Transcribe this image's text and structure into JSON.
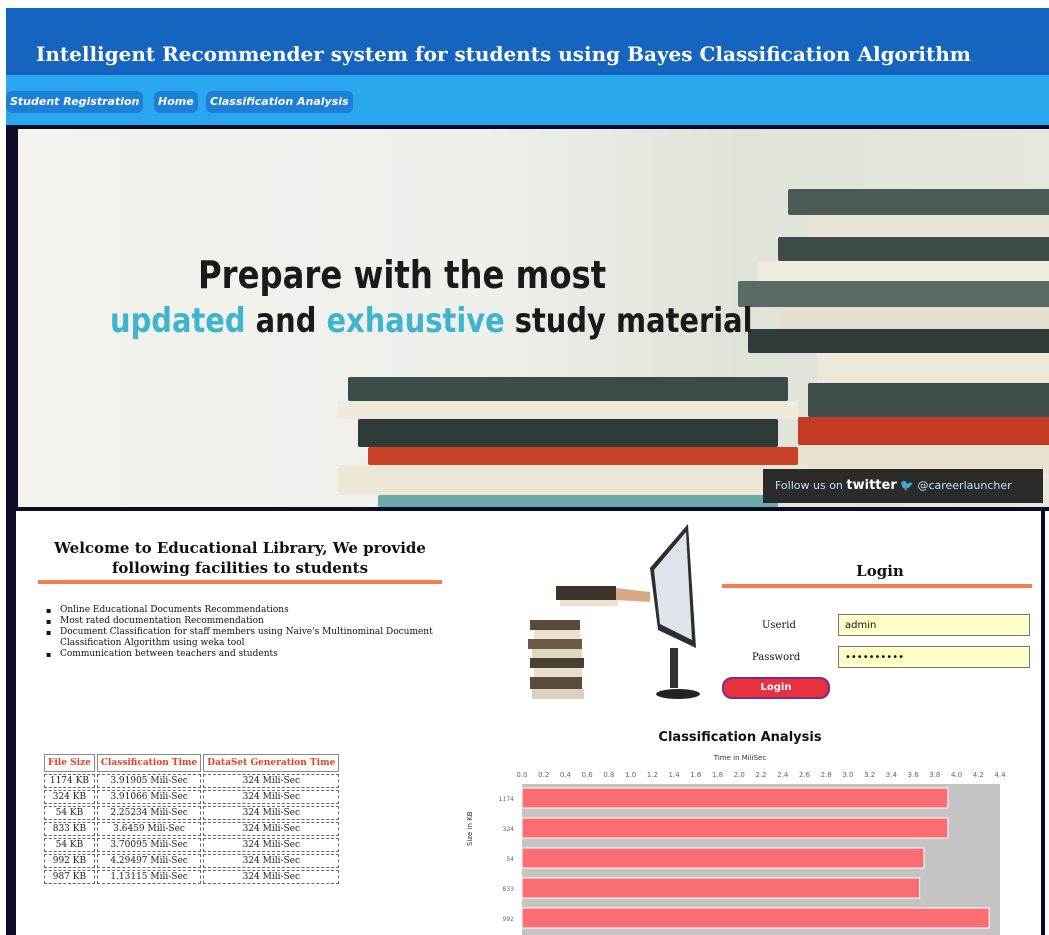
{
  "header": {
    "title": "Intelligent Recommender system for students using Bayes Classification Algorithm"
  },
  "nav": {
    "items": [
      "Student Registration",
      "Home",
      "Classification Analysis"
    ]
  },
  "banner": {
    "line1": "Prepare with the most",
    "line2_a": "updated",
    "line2_b": " and ",
    "line2_c": "exhaustive",
    "line2_d": " study material",
    "twitter_prefix": "Follow us on ",
    "twitter_brand": "twitter",
    "twitter_handle": "@careerlauncher"
  },
  "welcome": {
    "heading": "Welcome to Educational Library, We provide following facilities to students",
    "facilities": [
      "Online Educational Documents Recommendations",
      "Most rated documentation Recommendation",
      "Document Classification for staff members using Naive's Multinominal Document Classification Algorithm using weka tool",
      "Communication between teachers and students"
    ]
  },
  "table": {
    "headers": [
      "File Size",
      "Classification Time",
      "DataSet Generation Time"
    ],
    "rows": [
      [
        "1174 KB",
        "3.91905 Mili-Sec",
        "324 Mili-Sec"
      ],
      [
        "324 KB",
        "3.91066 Mili-Sec",
        "324 Mili-Sec"
      ],
      [
        "54 KB",
        "2.25234 Mili-Sec",
        "324 Mili-Sec"
      ],
      [
        "833 KB",
        "3.6459 Mili-Sec",
        "324 Mili-Sec"
      ],
      [
        "54 KB",
        "3.70095 Mili-Sec",
        "324 Mili-Sec"
      ],
      [
        "992 KB",
        "4.29497 Mili-Sec",
        "324 Mili-Sec"
      ],
      [
        "987 KB",
        "1.13115 Mili-Sec",
        "324 Mili-Sec"
      ]
    ]
  },
  "login": {
    "title": "Login",
    "userid_label": "Userid",
    "userid_value": "admin",
    "password_label": "Password",
    "password_value": "••••••••••",
    "button": "Login"
  },
  "colors": {
    "header": "#1565c0",
    "nav": "#29a8f0",
    "accent": "#3fb4cf",
    "rule": "#f07e4f",
    "bar": "#fb6d72",
    "login_button": "#e8303f"
  },
  "chart_data": {
    "type": "bar",
    "orientation": "horizontal",
    "title": "Classification Analysis",
    "xlabel": "Time in MiliSec",
    "ylabel": "Size in KB",
    "xlim": [
      0,
      4.4
    ],
    "xticks": [
      "0.0",
      "0.2",
      "0.4",
      "0.6",
      "0.8",
      "1.0",
      "1.2",
      "1.4",
      "1.6",
      "1.8",
      "2.0",
      "2.2",
      "2.4",
      "2.6",
      "2.8",
      "3.0",
      "3.2",
      "3.4",
      "3.6",
      "3.8",
      "4.0",
      "4.2",
      "4.4"
    ],
    "categories": [
      "1174",
      "324",
      "54",
      "833",
      "992"
    ],
    "values": [
      3.92,
      3.92,
      3.7,
      3.66,
      4.3
    ]
  }
}
